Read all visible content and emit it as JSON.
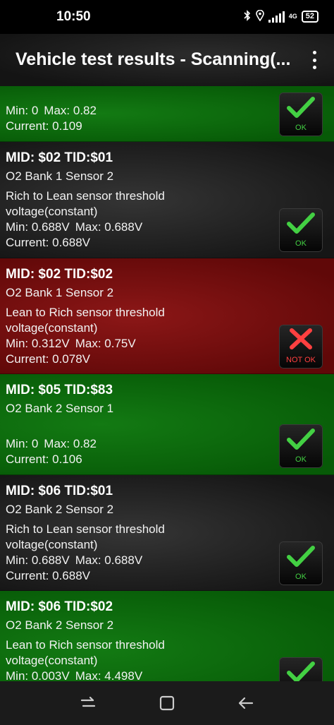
{
  "status": {
    "time": "10:50",
    "network": "4G",
    "battery": "52"
  },
  "app_bar": {
    "title": "Vehicle test results - Scanning(..."
  },
  "rows": [
    {
      "color": "green",
      "mid": "",
      "sensor": "",
      "desc1": "",
      "desc2": "",
      "min": "Min: 0",
      "max": "Max: 0.82",
      "current": "Current: 0.109",
      "status": "OK"
    },
    {
      "color": "black",
      "mid": "MID: $02 TID:$01",
      "sensor": "O2 Bank 1 Sensor 2",
      "desc1": "Rich to Lean sensor threshold",
      "desc2": "voltage(constant)",
      "min": "Min: 0.688V",
      "max": "Max: 0.688V",
      "current": "Current: 0.688V",
      "status": "OK"
    },
    {
      "color": "red",
      "mid": "MID: $02 TID:$02",
      "sensor": "O2 Bank 1 Sensor 2",
      "desc1": "Lean to Rich sensor threshold",
      "desc2": "voltage(constant)",
      "min": "Min: 0.312V",
      "max": "Max: 0.75V",
      "current": "Current: 0.078V",
      "status": "NOT OK"
    },
    {
      "color": "green",
      "mid": "MID: $05 TID:$83",
      "sensor": "O2 Bank 2 Sensor 1",
      "desc1": "",
      "desc2": "",
      "min": "Min: 0",
      "max": "Max: 0.82",
      "current": "Current: 0.106",
      "status": "OK"
    },
    {
      "color": "black",
      "mid": "MID: $06 TID:$01",
      "sensor": "O2 Bank 2 Sensor 2",
      "desc1": "Rich to Lean sensor threshold",
      "desc2": "voltage(constant)",
      "min": "Min: 0.688V",
      "max": "Max: 0.688V",
      "current": "Current: 0.688V",
      "status": "OK"
    },
    {
      "color": "green",
      "mid": "MID: $06 TID:$02",
      "sensor": "O2 Bank 2 Sensor 2",
      "desc1": "Lean to Rich sensor threshold",
      "desc2": "voltage(constant)",
      "min": "Min: 0.003V",
      "max": "Max: 4.498V",
      "current": "",
      "status": "OK"
    }
  ],
  "colors": {
    "ok_green": "#43d043",
    "not_ok_red": "#ff4040"
  },
  "nav": {
    "icons": [
      "recent-apps-icon",
      "home-icon",
      "back-icon"
    ]
  }
}
